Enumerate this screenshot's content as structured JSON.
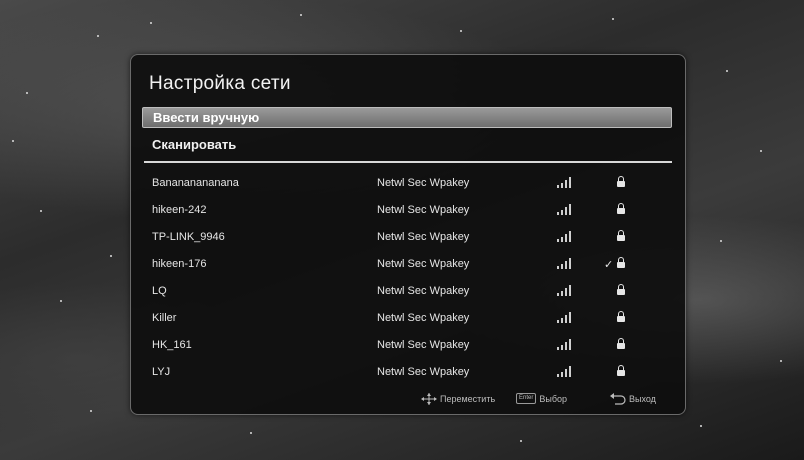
{
  "dialog": {
    "title": "Настройка сети",
    "menu": [
      {
        "label": "Ввести вручную"
      },
      {
        "label": "Сканировать"
      }
    ]
  },
  "networks": [
    {
      "name": "Banananananana",
      "security": "Netwl Sec Wpakey",
      "signal_icon": "signal-icon",
      "connected": false,
      "locked": true
    },
    {
      "name": "hikeen-242",
      "security": "Netwl Sec Wpakey",
      "signal_icon": "signal-icon",
      "connected": false,
      "locked": true
    },
    {
      "name": "TP-LINK_9946",
      "security": "Netwl Sec Wpakey",
      "signal_icon": "signal-icon",
      "connected": false,
      "locked": true
    },
    {
      "name": "hikeen-176",
      "security": "Netwl Sec Wpakey",
      "signal_icon": "signal-icon",
      "connected": true,
      "check": "✓",
      "locked": true
    },
    {
      "name": "LQ",
      "security": "Netwl Sec Wpakey",
      "signal_icon": "signal-icon",
      "connected": false,
      "locked": true
    },
    {
      "name": "Killer",
      "security": "Netwl Sec Wpakey",
      "signal_icon": "signal-icon",
      "connected": false,
      "locked": true
    },
    {
      "name": "HK_161",
      "security": "Netwl Sec Wpakey",
      "signal_icon": "signal-icon",
      "connected": false,
      "locked": true
    },
    {
      "name": "LYJ",
      "security": "Netwl Sec Wpakey",
      "signal_icon": "signal-icon",
      "connected": false,
      "locked": true
    }
  ],
  "footer": {
    "move_label": "Переместить",
    "enter_key": "Enter",
    "select_label": "Выбор",
    "exit_label": "Выход"
  }
}
